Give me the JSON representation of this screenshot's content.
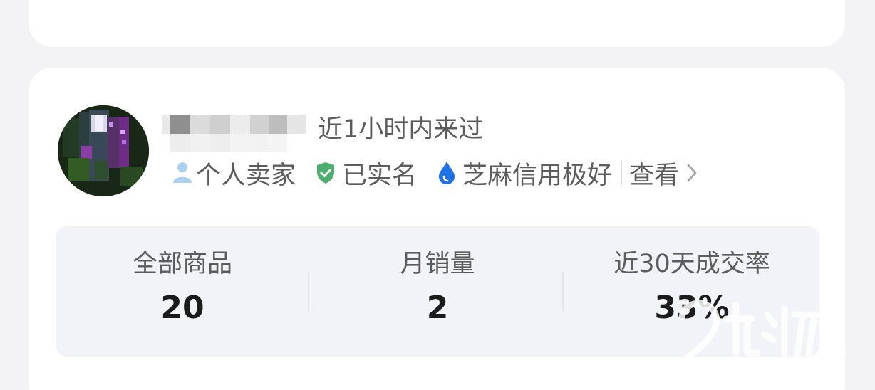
{
  "seller": {
    "last_seen": "近1小时内来过",
    "badges": {
      "personal_seller": "个人卖家",
      "verified": "已实名",
      "credit": "芝麻信用极好",
      "view": "查看"
    }
  },
  "stats": [
    {
      "label": "全部商品",
      "value": "20"
    },
    {
      "label": "月销量",
      "value": "2"
    },
    {
      "label": "近30天成交率",
      "value": "33%"
    }
  ],
  "colors": {
    "person_icon": "#a9d0ef",
    "verified_icon": "#4caf6f",
    "credit_icon": "#1f72e6"
  }
}
